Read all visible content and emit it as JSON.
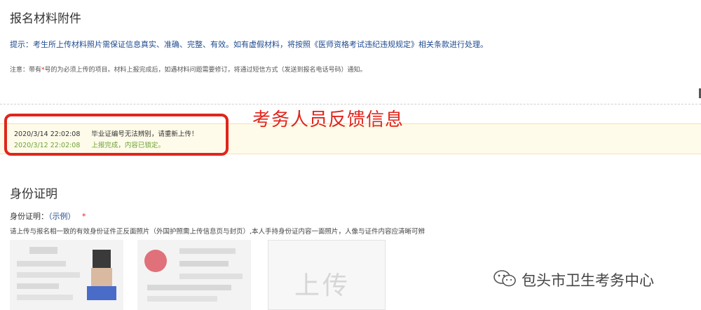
{
  "section1": {
    "title": "报名材料附件",
    "hint": "提示：考生所上传材料照片需保证信息真实、准确、完整、有效。如有虚假材料，将按照《医师资格考试违纪违规规定》相关条款进行处理。",
    "note_prefix": "注意：带有",
    "note_star": "*",
    "note_suffix": "号的为必须上传的项目。材料上报完成后，如遇材料问题需要修订，将通过短信方式（发送到报名电话号码）通知。"
  },
  "feedback": {
    "label": "考务人员反馈信息",
    "entries": [
      {
        "time": "2020/3/14 22:02:08",
        "message": "毕业证编号无法辨别，请重新上传！"
      },
      {
        "time": "2020/3/12 22:02:08",
        "message": "上报完成，内容已锁定。"
      }
    ]
  },
  "section2": {
    "title": "身份证明",
    "field_label": "身份证明：",
    "example_link": "（示例）",
    "required_star": "*",
    "description": "请上传与报名相一致的有效身份证件正反面照片（外国护照需上传信息页与封页）,本人手持身份证内容一面照片，人像与证件内容应清晰可辨",
    "upload_label": "上传"
  },
  "watermark": {
    "text": "包头市卫生考务中心",
    "icon": "wechat-icon"
  },
  "colors": {
    "hint_blue": "#1f4b8f",
    "required_red": "#e2231a",
    "annotation_red": "#e0261c",
    "success_green": "#6aa335",
    "feedback_bg": "#fffbea"
  }
}
